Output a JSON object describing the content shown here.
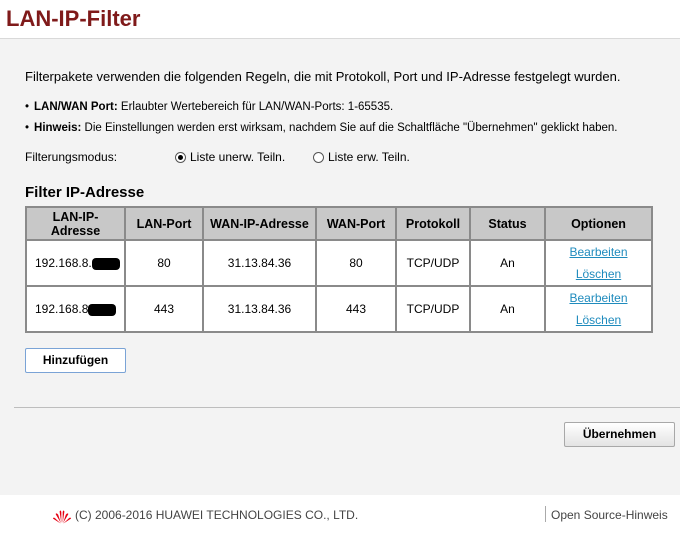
{
  "header": {
    "title": "LAN-IP-Filter"
  },
  "intro": "Filterpakete verwenden die folgenden Regeln, die mit Protokoll, Port und IP-Adresse festgelegt wurden.",
  "notes": [
    {
      "bullet": "•",
      "label": "LAN/WAN Port:",
      "text": " Erlaubter Wertebereich für LAN/WAN-Ports: 1-65535."
    },
    {
      "bullet": "•",
      "label": "Hinweis:",
      "text": " Die Einstellungen werden erst wirksam, nachdem Sie auf die Schaltfläche \"Übernehmen\" geklickt haben."
    }
  ],
  "filter_mode": {
    "label": "Filterungsmodus:",
    "options": [
      "Liste unerw. Teiln.",
      "Liste erw. Teiln."
    ],
    "selected": "Liste unerw. Teiln."
  },
  "table": {
    "title": "Filter IP-Adresse",
    "headers": [
      "LAN-IP-Adresse",
      "LAN-Port",
      "WAN-IP-Adresse",
      "WAN-Port",
      "Protokoll",
      "Status",
      "Optionen"
    ],
    "rows": [
      {
        "lan_ip": "192.168.8.",
        "lan_port": "80",
        "wan_ip": "31.13.84.36",
        "wan_port": "80",
        "protocol": "TCP/UDP",
        "status": "An",
        "edit": "Bearbeiten",
        "delete": "Löschen"
      },
      {
        "lan_ip": "192.168.8",
        "lan_port": "443",
        "wan_ip": "31.13.84.36",
        "wan_port": "443",
        "protocol": "TCP/UDP",
        "status": "An",
        "edit": "Bearbeiten",
        "delete": "Löschen"
      }
    ]
  },
  "buttons": {
    "add": "Hinzufügen",
    "apply": "Übernehmen"
  },
  "footer": {
    "copyright": "(C) 2006-2016 HUAWEI TECHNOLOGIES CO., LTD.",
    "open_source": "Open Source-Hinweis",
    "logo_icon": "huawei-logo-icon",
    "logo_color": "#e60012"
  },
  "colors": {
    "title": "#7f1a1a",
    "link": "#1f8bbd",
    "table_header": "#c8c8c8"
  }
}
